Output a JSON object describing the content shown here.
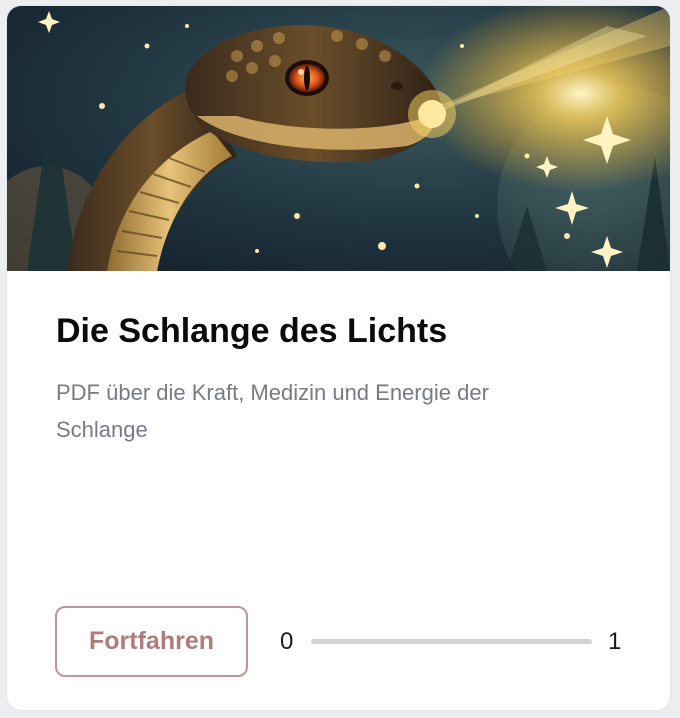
{
  "course": {
    "title": "Die Schlange des Lichts",
    "description": "PDF über die Kraft, Medizin und Energie der Schlange",
    "hero_image": "glowing-serpent-under-starry-night-sky"
  },
  "actions": {
    "continue_label": "Fortfahren"
  },
  "progress": {
    "min_label": "0",
    "max_label": "1",
    "value": 0,
    "max": 1
  },
  "colors": {
    "accent": "#b07b7d",
    "accent_border": "#c29596",
    "title": "#0b0b0c",
    "description": "#767b85",
    "track": "#d4d4d6",
    "page_bg": "#eceef2"
  }
}
